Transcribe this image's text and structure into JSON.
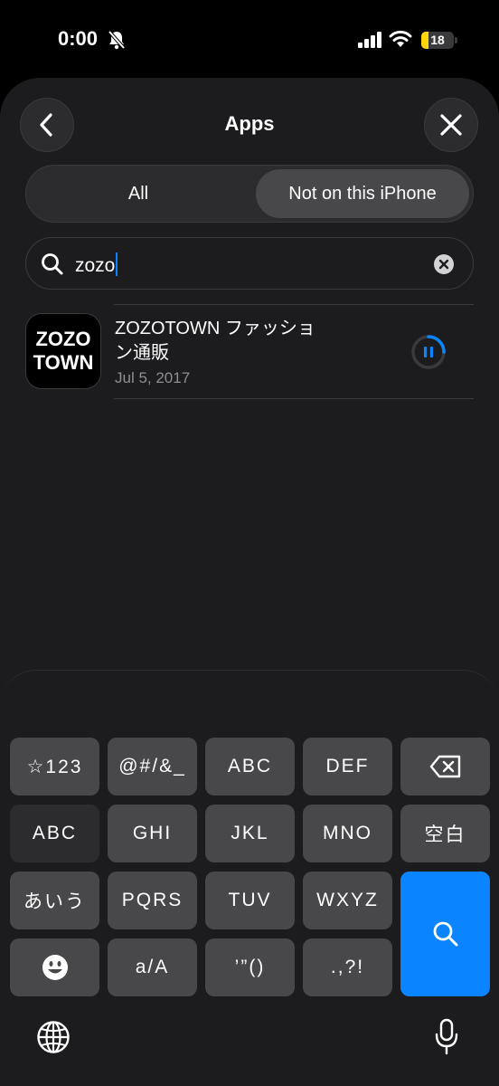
{
  "status": {
    "time": "0:00",
    "battery": "18"
  },
  "sheet": {
    "title": "Apps"
  },
  "segments": {
    "all": "All",
    "not_on": "Not on this iPhone"
  },
  "search": {
    "query": "zozo"
  },
  "app": {
    "icon_line1": "ZOZO",
    "icon_line2": "TOWN",
    "name_line1": "ZOZOTOWN ファッショ",
    "name_line2": "ン通販",
    "date": "Jul 5, 2017",
    "download_progress": 0.25
  },
  "keyboard": {
    "row1": [
      "☆123",
      "@#/&_",
      "ABC",
      "DEF"
    ],
    "row2": [
      "ABC",
      "GHI",
      "JKL",
      "MNO",
      "空白"
    ],
    "row3": [
      "あいう",
      "PQRS",
      "TUV",
      "WXYZ"
    ],
    "row4": [
      "a/A",
      "’”()",
      ".,?!"
    ]
  },
  "colors": {
    "accent": "#0a84ff",
    "battery": "#ffd60a",
    "sheet": "#1c1c1e"
  }
}
